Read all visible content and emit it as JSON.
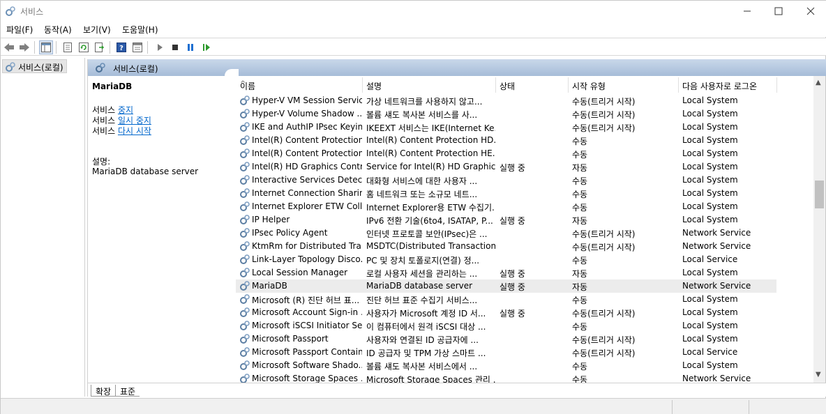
{
  "window": {
    "title": "서비스",
    "controls": {
      "minimize": "─",
      "maximize": "☐",
      "close": "✕"
    }
  },
  "menu": [
    "파일(F)",
    "동작(A)",
    "보기(V)",
    "도움말(H)"
  ],
  "toolbar": {
    "icons": [
      "back-icon",
      "forward-icon",
      "show-hide-tree-icon",
      "properties-icon",
      "refresh-icon",
      "export-list-icon",
      "help-icon",
      "view-icon",
      "start-service-icon",
      "stop-service-icon",
      "pause-service-icon",
      "resume-service-icon"
    ]
  },
  "tree": {
    "root_label": "서비스(로컬)"
  },
  "panel": {
    "title": "서비스(로컬)",
    "selected_service": {
      "name": "MariaDB",
      "actions": [
        {
          "prefix": "서비스 ",
          "link": "중지"
        },
        {
          "prefix": "서비스 ",
          "link": "일시 중지"
        },
        {
          "prefix": "서비스 ",
          "link": "다시 시작"
        }
      ],
      "description_label": "설명:",
      "description": "MariaDB database server"
    }
  },
  "columns": [
    "이름",
    "설명",
    "상태",
    "시작 유형",
    "다음 사용자로 로그온"
  ],
  "services": [
    {
      "name": "Hyper-V VM Session Service",
      "desc": "가상 네트워크를 사용하지 않고...",
      "state": "",
      "start": "수동(트리거 시작)",
      "logon": "Local System"
    },
    {
      "name": "Hyper-V Volume Shadow ...",
      "desc": "볼륨 섀도 복사본 서비스를 사...",
      "state": "",
      "start": "수동(트리거 시작)",
      "logon": "Local System"
    },
    {
      "name": "IKE and AuthIP IPsec Keyin...",
      "desc": "IKEEXT 서비스는 IKE(Internet Ke...",
      "state": "",
      "start": "수동(트리거 시작)",
      "logon": "Local System"
    },
    {
      "name": "Intel(R) Content Protection...",
      "desc": "Intel(R) Content Protection HD...",
      "state": "",
      "start": "수동",
      "logon": "Local System"
    },
    {
      "name": "Intel(R) Content Protection...",
      "desc": "Intel(R) Content Protection HE...",
      "state": "",
      "start": "수동",
      "logon": "Local System"
    },
    {
      "name": "Intel(R) HD Graphics Contr...",
      "desc": "Service for Intel(R) HD Graphic...",
      "state": "실행 중",
      "start": "자동",
      "logon": "Local System"
    },
    {
      "name": "Interactive Services Detecti...",
      "desc": "대화형 서비스에 대한 사용자 ...",
      "state": "",
      "start": "수동",
      "logon": "Local System"
    },
    {
      "name": "Internet Connection Sharin...",
      "desc": "홈 네트워크 또는 소규모 네트...",
      "state": "",
      "start": "수동",
      "logon": "Local System"
    },
    {
      "name": "Internet Explorer ETW Colle...",
      "desc": "Internet Explorer용 ETW 수집기...",
      "state": "",
      "start": "수동",
      "logon": "Local System"
    },
    {
      "name": "IP Helper",
      "desc": "IPv6 전환 기술(6to4, ISATAP, P...",
      "state": "실행 중",
      "start": "자동",
      "logon": "Local System"
    },
    {
      "name": "IPsec Policy Agent",
      "desc": "인터넷 프로토콜 보안(IPsec)은 ...",
      "state": "",
      "start": "수동(트리거 시작)",
      "logon": "Network Service"
    },
    {
      "name": "KtmRm for Distributed Tra...",
      "desc": "MSDTC(Distributed Transaction...",
      "state": "",
      "start": "수동(트리거 시작)",
      "logon": "Network Service"
    },
    {
      "name": "Link-Layer Topology Disco...",
      "desc": "PC 및 장치 토폴로지(연결) 정...",
      "state": "",
      "start": "수동",
      "logon": "Local Service"
    },
    {
      "name": "Local Session Manager",
      "desc": "로컬 사용자 세션을 관리하는 ...",
      "state": "실행 중",
      "start": "자동",
      "logon": "Local System"
    },
    {
      "name": "MariaDB",
      "desc": "MariaDB database server",
      "state": "실행 중",
      "start": "자동",
      "logon": "Network Service"
    },
    {
      "name": "Microsoft (R) 진단 허브 표...",
      "desc": "진단 허브 표준 수집기 서비스...",
      "state": "",
      "start": "수동",
      "logon": "Local System"
    },
    {
      "name": "Microsoft Account Sign-in ...",
      "desc": "사용자가 Microsoft 계정 ID 서...",
      "state": "실행 중",
      "start": "수동(트리거 시작)",
      "logon": "Local System"
    },
    {
      "name": "Microsoft iSCSI Initiator Se...",
      "desc": "이 컴퓨터에서 원격 iSCSI 대상 ...",
      "state": "",
      "start": "수동",
      "logon": "Local System"
    },
    {
      "name": "Microsoft Passport",
      "desc": "사용자와 연결된 ID 공급자에 ...",
      "state": "",
      "start": "수동(트리거 시작)",
      "logon": "Local System"
    },
    {
      "name": "Microsoft Passport Container",
      "desc": "ID 공급자 및 TPM 가상 스마트 ...",
      "state": "",
      "start": "수동(트리거 시작)",
      "logon": "Local Service"
    },
    {
      "name": "Microsoft Software Shado...",
      "desc": "볼륨 섀도 복사본 서비스에서 ...",
      "state": "",
      "start": "수동",
      "logon": "Local System"
    },
    {
      "name": "Microsoft Storage Spaces ...",
      "desc": "Microsoft Storage Spaces 관리 ...",
      "state": "",
      "start": "수동",
      "logon": "Network Service"
    }
  ],
  "selected_index": 14,
  "tabs": [
    "확장",
    "표준"
  ]
}
